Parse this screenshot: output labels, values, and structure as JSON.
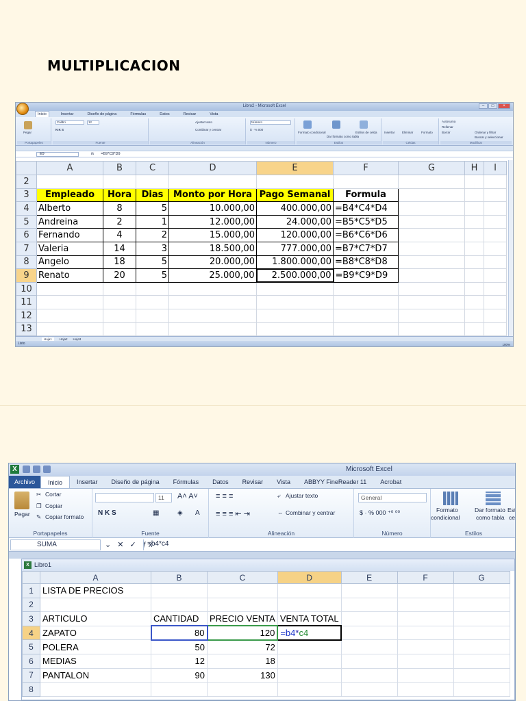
{
  "document": {
    "title": "MULTIPLICACION"
  },
  "shot1": {
    "window_title": "Libro2 - Microsoft Excel",
    "tabs": [
      "Inicio",
      "Insertar",
      "Diseño de página",
      "Fórmulas",
      "Datos",
      "Revisar",
      "Vista"
    ],
    "active_tab": "Inicio",
    "ribbon": {
      "paste": "Pegar",
      "font": "Calibri",
      "size": "12",
      "wrap": "Ajustar texto",
      "merge": "Combinar y centrar",
      "number_format": "Número",
      "cond_format": "Formato condicional",
      "table_format": "Dar formato como tabla",
      "cell_styles": "Estilos de celda",
      "insert": "Insertar",
      "delete": "Eliminar",
      "format": "Formato",
      "autosum": "Autosuma",
      "fill": "Rellenar",
      "clear": "Borrar",
      "sort": "Ordenar y filtrar",
      "find": "Buscar y seleccionar",
      "groups": [
        "Portapapeles",
        "Fuente",
        "Alineación",
        "Número",
        "Estilos",
        "Celdas",
        "Modificar"
      ]
    },
    "name_box": "E9",
    "fx": "fx",
    "formula": "=B9*C9*D9",
    "columns": [
      "A",
      "B",
      "C",
      "D",
      "E",
      "F",
      "G",
      "H",
      "I"
    ],
    "rows": [
      "2",
      "3",
      "4",
      "5",
      "6",
      "7",
      "8",
      "9",
      "10",
      "11",
      "12",
      "13"
    ],
    "header": [
      "Empleado",
      "Hora",
      "Dias",
      "Monto por Hora",
      "Pago Semanal",
      "Formula"
    ],
    "data": [
      [
        "Alberto",
        "8",
        "5",
        "10.000,00",
        "400.000,00",
        "=B4*C4*D4"
      ],
      [
        "Andreina",
        "2",
        "1",
        "12.000,00",
        "24.000,00",
        "=B5*C5*D5"
      ],
      [
        "Fernando",
        "4",
        "2",
        "15.000,00",
        "120.000,00",
        "=B6*C6*D6"
      ],
      [
        "Valeria",
        "14",
        "3",
        "18.500,00",
        "777.000,00",
        "=B7*C7*D7"
      ],
      [
        "Angelo",
        "18",
        "5",
        "20.000,00",
        "1.800.000,00",
        "=B8*C8*D8"
      ],
      [
        "Renato",
        "20",
        "5",
        "25.000,00",
        "2.500.000,00",
        "=B9*C9*D9"
      ]
    ],
    "sheet_tabs": [
      "Hoja1",
      "Hoja2",
      "Hoja3"
    ],
    "status": "Listo",
    "zoom": "100%"
  },
  "shot2": {
    "window_title": "Microsoft Excel",
    "tabs": [
      "Archivo",
      "Inicio",
      "Insertar",
      "Diseño de página",
      "Fórmulas",
      "Datos",
      "Revisar",
      "Vista",
      "ABBYY FineReader 11",
      "Acrobat"
    ],
    "ribbon": {
      "cut": "Cortar",
      "copy": "Copiar",
      "copy_format": "Copiar formato",
      "paste": "Pegar",
      "font_size": "11",
      "wrap": "Ajustar texto",
      "merge": "Combinar y centrar",
      "number_format": "General",
      "cond_format_1": "Formato",
      "cond_format_2": "condicional",
      "table_format_1": "Dar formato",
      "table_format_2": "como tabla",
      "styles_1": "Est",
      "styles_2": "ce",
      "groups": [
        "Portapapeles",
        "Fuente",
        "Alineación",
        "Número",
        "Estilos"
      ]
    },
    "name_box": "SUMA",
    "formula": "=b4*c4",
    "workbook_title": "Libro1",
    "columns": [
      "A",
      "B",
      "C",
      "D",
      "E",
      "F",
      "G"
    ],
    "rows": [
      "1",
      "2",
      "3",
      "4",
      "5",
      "6",
      "7",
      "8"
    ],
    "cells": {
      "a1": "LISTA DE PRECIOS",
      "a3": "ARTICULO",
      "b3": "CANTIDAD",
      "c3": "PRECIO VENTA",
      "d3": "VENTA TOTAL",
      "d4_ref1": "=b4",
      "d4_op": "*",
      "d4_ref2": "c4"
    },
    "items": [
      [
        "ZAPATO",
        "80",
        "120"
      ],
      [
        "POLERA",
        "50",
        "72"
      ],
      [
        "MEDIAS",
        "12",
        "18"
      ],
      [
        "PANTALON",
        "90",
        "130"
      ]
    ]
  }
}
